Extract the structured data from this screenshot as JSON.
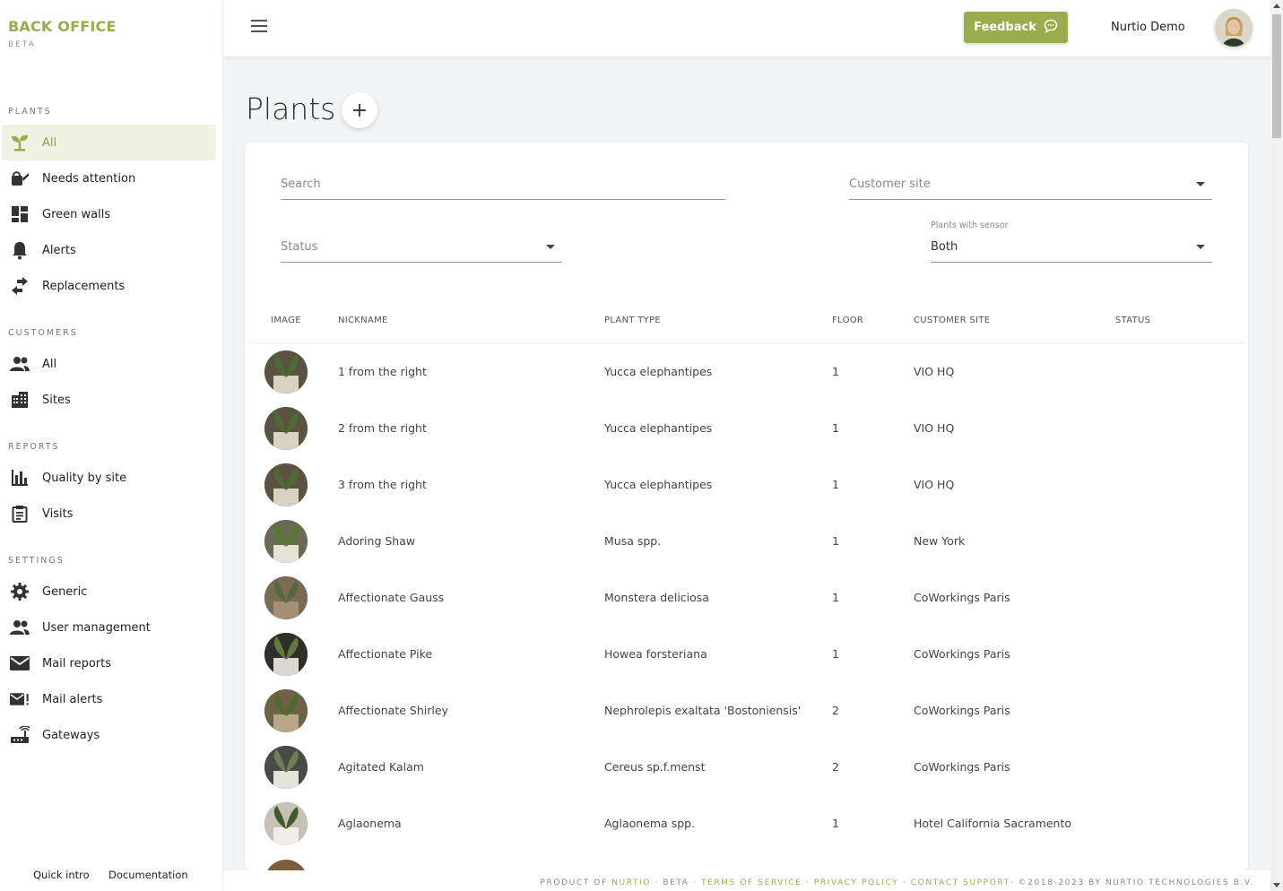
{
  "brand": {
    "title": "BACK OFFICE",
    "subtitle": "BETA"
  },
  "sidebar": {
    "sections": [
      {
        "title": "PLANTS",
        "items": [
          {
            "label": "All",
            "icon": "sprout-icon",
            "active": true
          },
          {
            "label": "Needs attention",
            "icon": "watering-can-icon"
          },
          {
            "label": "Green walls",
            "icon": "dashboard-grid-icon"
          },
          {
            "label": "Alerts",
            "icon": "bell-icon"
          },
          {
            "label": "Replacements",
            "icon": "swap-arrows-icon"
          }
        ]
      },
      {
        "title": "CUSTOMERS",
        "items": [
          {
            "label": "All",
            "icon": "people-icon"
          },
          {
            "label": "Sites",
            "icon": "building-icon"
          }
        ]
      },
      {
        "title": "REPORTS",
        "items": [
          {
            "label": "Quality by site",
            "icon": "bar-chart-icon"
          },
          {
            "label": "Visits",
            "icon": "clipboard-icon"
          }
        ]
      },
      {
        "title": "SETTINGS",
        "items": [
          {
            "label": "Generic",
            "icon": "gear-icon"
          },
          {
            "label": "User management",
            "icon": "people-icon"
          },
          {
            "label": "Mail reports",
            "icon": "mail-icon"
          },
          {
            "label": "Mail alerts",
            "icon": "mail-alert-icon"
          },
          {
            "label": "Gateways",
            "icon": "router-icon"
          }
        ]
      }
    ],
    "footer": {
      "quick_intro": "Quick intro",
      "documentation": "Documentation"
    }
  },
  "topbar": {
    "feedback_label": "Feedback",
    "user_name": "Nurtio Demo"
  },
  "page": {
    "title": "Plants",
    "add_label": "+"
  },
  "filters": {
    "search_placeholder": "Search",
    "customer_site_placeholder": "Customer site",
    "status_placeholder": "Status",
    "sensor_label": "Plants with sensor",
    "sensor_value": "Both"
  },
  "table": {
    "headers": [
      "IMAGE",
      "NICKNAME",
      "PLANT TYPE",
      "FLOOR",
      "CUSTOMER SITE",
      "STATUS"
    ],
    "rows": [
      {
        "nickname": "1 from the right",
        "plant_type": "Yucca elephantipes",
        "floor": "1",
        "site": "VIO HQ",
        "status": ""
      },
      {
        "nickname": "2 from the right",
        "plant_type": "Yucca elephantipes",
        "floor": "1",
        "site": "VIO HQ",
        "status": ""
      },
      {
        "nickname": "3 from the right",
        "plant_type": "Yucca elephantipes",
        "floor": "1",
        "site": "VIO HQ",
        "status": ""
      },
      {
        "nickname": "Adoring Shaw",
        "plant_type": "Musa spp.",
        "floor": "1",
        "site": "New York",
        "status": ""
      },
      {
        "nickname": "Affectionate Gauss",
        "plant_type": "Monstera deliciosa",
        "floor": "1",
        "site": "CoWorkings Paris",
        "status": ""
      },
      {
        "nickname": "Affectionate Pike",
        "plant_type": "Howea forsteriana",
        "floor": "1",
        "site": "CoWorkings Paris",
        "status": ""
      },
      {
        "nickname": "Affectionate Shirley",
        "plant_type": "Nephrolepis exaltata 'Bostoniensis'",
        "floor": "2",
        "site": "CoWorkings Paris",
        "status": ""
      },
      {
        "nickname": "Agitated Kalam",
        "plant_type": "Cereus sp.f.menst",
        "floor": "2",
        "site": "CoWorkings Paris",
        "status": ""
      },
      {
        "nickname": "Aglaonema",
        "plant_type": "Aglaonema spp.",
        "floor": "1",
        "site": "Hotel California Sacramento",
        "status": ""
      }
    ]
  },
  "footer": {
    "product_of": "PRODUCT OF",
    "nurtio": "NURTIO",
    "beta": "BETA",
    "terms": "TERMS OF SERVICE",
    "privacy": "PRIVACY POLICY",
    "contact": "CONTACT SUPPORT",
    "copyright": "©2018-2023 BY NURTIO TECHNOLOGIES B.V."
  },
  "colors": {
    "accent": "#9aac4d",
    "active_bg": "#f0f3e4"
  }
}
